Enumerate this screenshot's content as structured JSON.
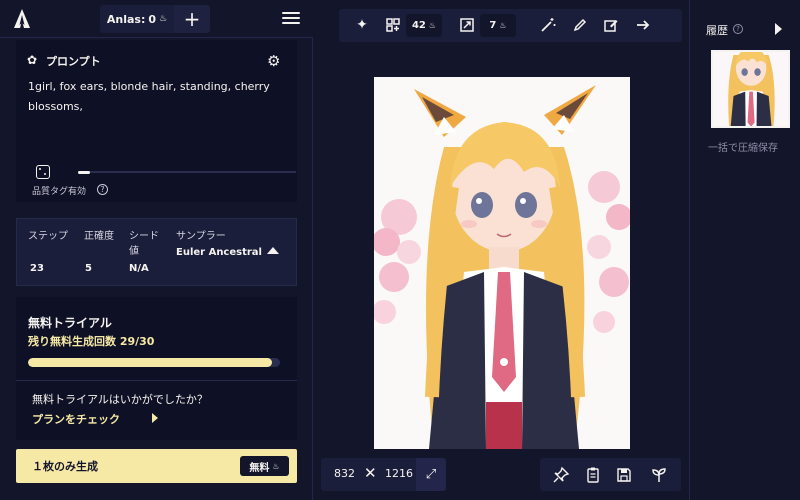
{
  "header": {
    "anlas_label": "Anlas:",
    "anlas_value": "0",
    "anlas_symbol": "♨"
  },
  "prompt": {
    "title": "プロンプト",
    "text": "1girl, fox ears, blonde hair, standing, cherry blossoms,",
    "quality_tag_label": "品質タグ有効",
    "quality_tag_help": "?"
  },
  "params": {
    "steps_label": "ステップ",
    "steps_value": "23",
    "guidance_label": "正確度",
    "guidance_value": "5",
    "seed_label": "シード値",
    "seed_value": "N/A",
    "sampler_label": "サンプラー",
    "sampler_value": "Euler Ancestral"
  },
  "trial": {
    "title": "無料トライアル",
    "remaining": "残り無料生成回数 29/30",
    "progress_fraction": 0.967,
    "question": "無料トライアルはいかがでしたか？",
    "plan_link": "プランをチェック"
  },
  "generate": {
    "label": "１枚のみ生成",
    "badge_label": "無料",
    "badge_symbol": "♨"
  },
  "toolbar": {
    "variations_cost": "42",
    "upscale_cost": "7",
    "cost_symbol": "♨"
  },
  "image": {
    "width": "832",
    "times": "✕",
    "height": "1216"
  },
  "history": {
    "title": "履歴",
    "help": "?",
    "save_all": "一括で圧縮保存"
  },
  "colors": {
    "background": "#13152b",
    "panel": "#0e1025",
    "accent_yellow": "#f6e9a6"
  }
}
